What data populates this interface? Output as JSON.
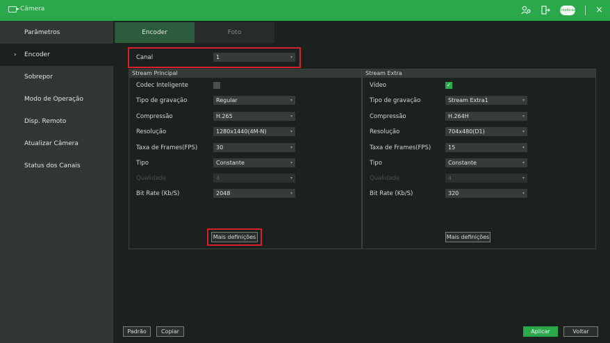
{
  "window": {
    "title": "Câmera"
  },
  "sidebar": {
    "items": [
      {
        "label": "Parâmetros"
      },
      {
        "label": "Encoder",
        "arrow": "›"
      },
      {
        "label": "Sobrepor"
      },
      {
        "label": "Modo de Operação"
      },
      {
        "label": "Disp. Remoto"
      },
      {
        "label": "Atualizar Câmera"
      },
      {
        "label": "Status dos Canais"
      }
    ]
  },
  "tabs": [
    {
      "label": "Encoder"
    },
    {
      "label": "Foto"
    }
  ],
  "canal": {
    "label": "Canal",
    "value": "1"
  },
  "main_stream": {
    "title": "Stream Principal",
    "codec": {
      "label": "Codec Inteligente"
    },
    "tipo_gravacao": {
      "label": "Tipo de gravação",
      "value": "Regular"
    },
    "compressao": {
      "label": "Compressão",
      "value": "H.265"
    },
    "resolucao": {
      "label": "Resolução",
      "value": "1280x1440(4M-N)"
    },
    "fps": {
      "label": "Taxa de Frames(FPS)",
      "value": "30"
    },
    "tipo": {
      "label": "Tipo",
      "value": "Constante"
    },
    "qualidade": {
      "label": "Qualidade",
      "value": "4"
    },
    "bitrate": {
      "label": "Bit Rate (Kb/S)",
      "value": "2048"
    },
    "mais": "Mais definições"
  },
  "extra_stream": {
    "title": "Stream Extra",
    "video": {
      "label": "Vídeo"
    },
    "tipo_gravacao": {
      "label": "Tipo de gravação",
      "value": "Stream Extra1"
    },
    "compressao": {
      "label": "Compressão",
      "value": "H.264H"
    },
    "resolucao": {
      "label": "Resolução",
      "value": "704x480(D1)"
    },
    "fps": {
      "label": "Taxa de Frames(FPS)",
      "value": "15"
    },
    "tipo": {
      "label": "Tipo",
      "value": "Constante"
    },
    "qualidade": {
      "label": "Qualidade",
      "value": "4"
    },
    "bitrate": {
      "label": "Bit Rate (Kb/S)",
      "value": "320"
    },
    "mais": "Mais definições"
  },
  "footer": {
    "padrao": "Padrão",
    "copiar": "Copiar",
    "aplicar": "Aplicar",
    "voltar": "Voltar"
  },
  "icons": {
    "dropdown": "▾",
    "check": "✓",
    "close": "×",
    "cloud_text": "Intelbras Cloud"
  },
  "colors": {
    "accent": "#2aa84a",
    "highlight": "#d6202a"
  }
}
